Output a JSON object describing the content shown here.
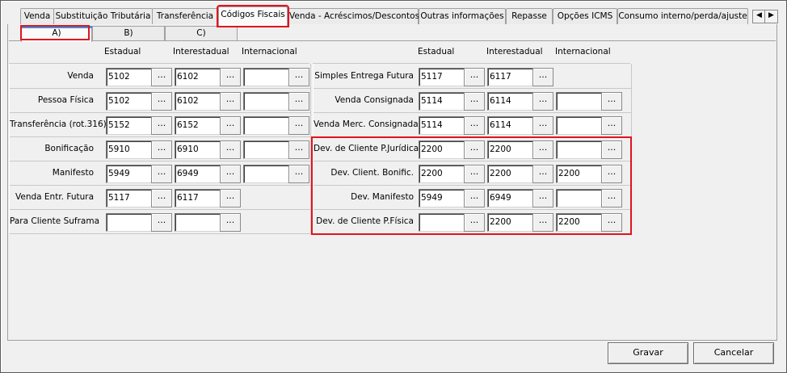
{
  "tabs": [
    "Venda",
    "Substituição Tributária",
    "Transferência",
    "Códigos Fiscais",
    "Venda - Acréscimos/Descontos",
    "Outras informações",
    "Repasse",
    "Opções ICMS",
    "Consumo interno/perda/ajuste"
  ],
  "tab_scroll": {
    "left": "◀",
    "right": "▶"
  },
  "subtabs": [
    "A)",
    "B)",
    "C)"
  ],
  "columns": {
    "estadual": "Estadual",
    "interestadual": "Interestadual",
    "internacional": "Internacional"
  },
  "browse_label": "...",
  "left_rows": [
    {
      "label": "Venda",
      "estadual": "5102",
      "interestadual": "6102",
      "internacional": ""
    },
    {
      "label": "Pessoa Física",
      "estadual": "5102",
      "interestadual": "6102",
      "internacional": ""
    },
    {
      "label": "Transferência (rot.316)",
      "estadual": "5152",
      "interestadual": "6152",
      "internacional": ""
    },
    {
      "label": "Bonificação",
      "estadual": "5910",
      "interestadual": "6910",
      "internacional": ""
    },
    {
      "label": "Manifesto",
      "estadual": "5949",
      "interestadual": "6949",
      "internacional": ""
    },
    {
      "label": "Venda Entr. Futura",
      "estadual": "5117",
      "interestadual": "6117"
    },
    {
      "label": "Para Cliente Suframa",
      "estadual": "",
      "interestadual": ""
    }
  ],
  "right_rows": [
    {
      "label": "Simples Entrega Futura",
      "estadual": "5117",
      "interestadual": "6117"
    },
    {
      "label": "Venda Consignada",
      "estadual": "5114",
      "interestadual": "6114",
      "internacional": ""
    },
    {
      "label": "Venda Merc. Consignada",
      "estadual": "5114",
      "interestadual": "6114",
      "internacional": ""
    },
    {
      "label": "Dev. de Cliente P.Jurídica",
      "estadual": "2200",
      "interestadual": "2200",
      "internacional": ""
    },
    {
      "label": "Dev. Client. Bonific.",
      "estadual": "2200",
      "interestadual": "2200",
      "internacional": "2200"
    },
    {
      "label": "Dev. Manifesto",
      "estadual": "5949",
      "interestadual": "6949",
      "internacional": ""
    },
    {
      "label": "Dev. de Cliente P.Física",
      "estadual": "",
      "interestadual": "2200",
      "internacional": "2200"
    }
  ],
  "buttons": {
    "save": "Gravar",
    "cancel": "Cancelar"
  },
  "colors": {
    "highlight": "#e0141e",
    "selected_tab_accent": "#3c8ee0"
  }
}
